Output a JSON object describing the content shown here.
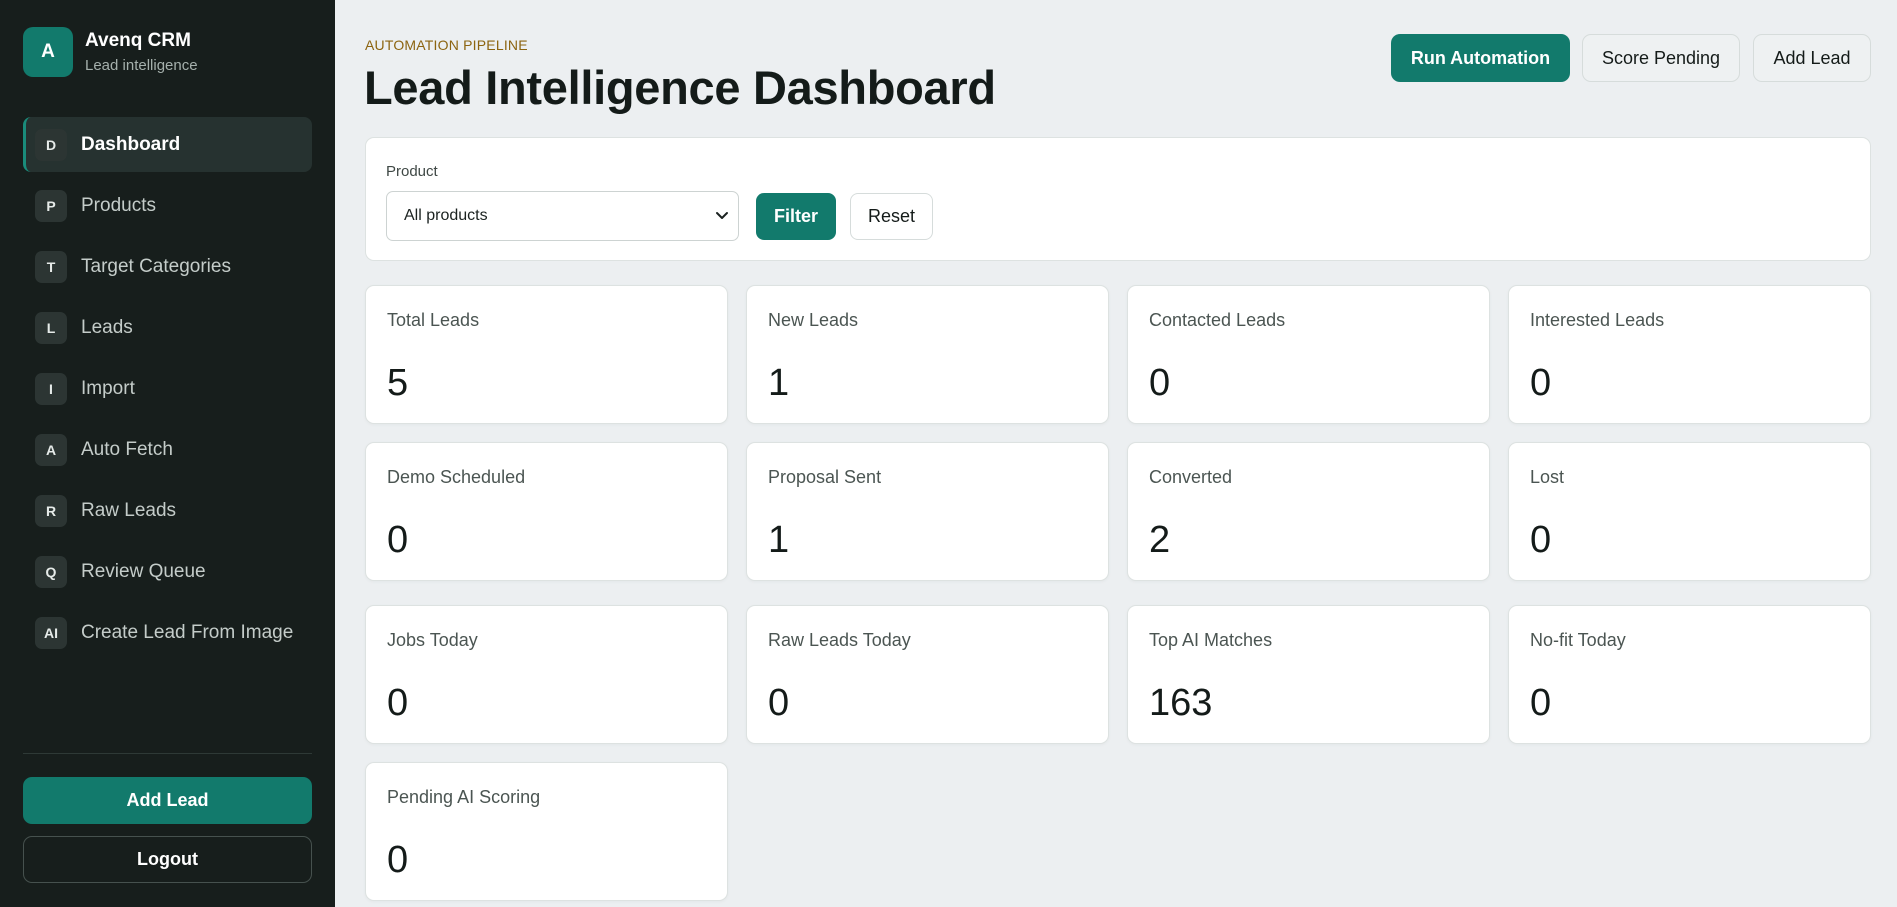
{
  "brand": {
    "initial": "A",
    "name": "Avenq CRM",
    "subtitle": "Lead intelligence"
  },
  "sidebar": {
    "items": [
      {
        "letter": "D",
        "label": "Dashboard",
        "active": true
      },
      {
        "letter": "P",
        "label": "Products"
      },
      {
        "letter": "T",
        "label": "Target Categories"
      },
      {
        "letter": "L",
        "label": "Leads"
      },
      {
        "letter": "I",
        "label": "Import"
      },
      {
        "letter": "A",
        "label": "Auto Fetch"
      },
      {
        "letter": "R",
        "label": "Raw Leads"
      },
      {
        "letter": "Q",
        "label": "Review Queue"
      },
      {
        "letter": "AI",
        "label": "Create Lead From Image"
      }
    ],
    "add_lead_label": "Add Lead",
    "logout_label": "Logout"
  },
  "header": {
    "eyebrow": "AUTOMATION PIPELINE",
    "title": "Lead Intelligence Dashboard",
    "run_automation_label": "Run Automation",
    "score_pending_label": "Score Pending",
    "add_lead_label": "Add Lead"
  },
  "filter": {
    "product_label": "Product",
    "selected_product": "All products",
    "filter_label": "Filter",
    "reset_label": "Reset"
  },
  "stats": [
    {
      "label": "Total Leads",
      "value": "5"
    },
    {
      "label": "New Leads",
      "value": "1"
    },
    {
      "label": "Contacted Leads",
      "value": "0"
    },
    {
      "label": "Interested Leads",
      "value": "0"
    },
    {
      "label": "Demo Scheduled",
      "value": "0"
    },
    {
      "label": "Proposal Sent",
      "value": "1"
    },
    {
      "label": "Converted",
      "value": "2"
    },
    {
      "label": "Lost",
      "value": "0"
    },
    {
      "label": "Jobs Today",
      "value": "0"
    },
    {
      "label": "Raw Leads Today",
      "value": "0"
    },
    {
      "label": "Top AI Matches",
      "value": "163"
    },
    {
      "label": "No-fit Today",
      "value": "0"
    },
    {
      "label": "Pending AI Scoring",
      "value": "0"
    }
  ],
  "colors": {
    "accent": "#127a6c",
    "sidebar_bg": "#171e1c",
    "eyebrow": "#8c6410"
  }
}
